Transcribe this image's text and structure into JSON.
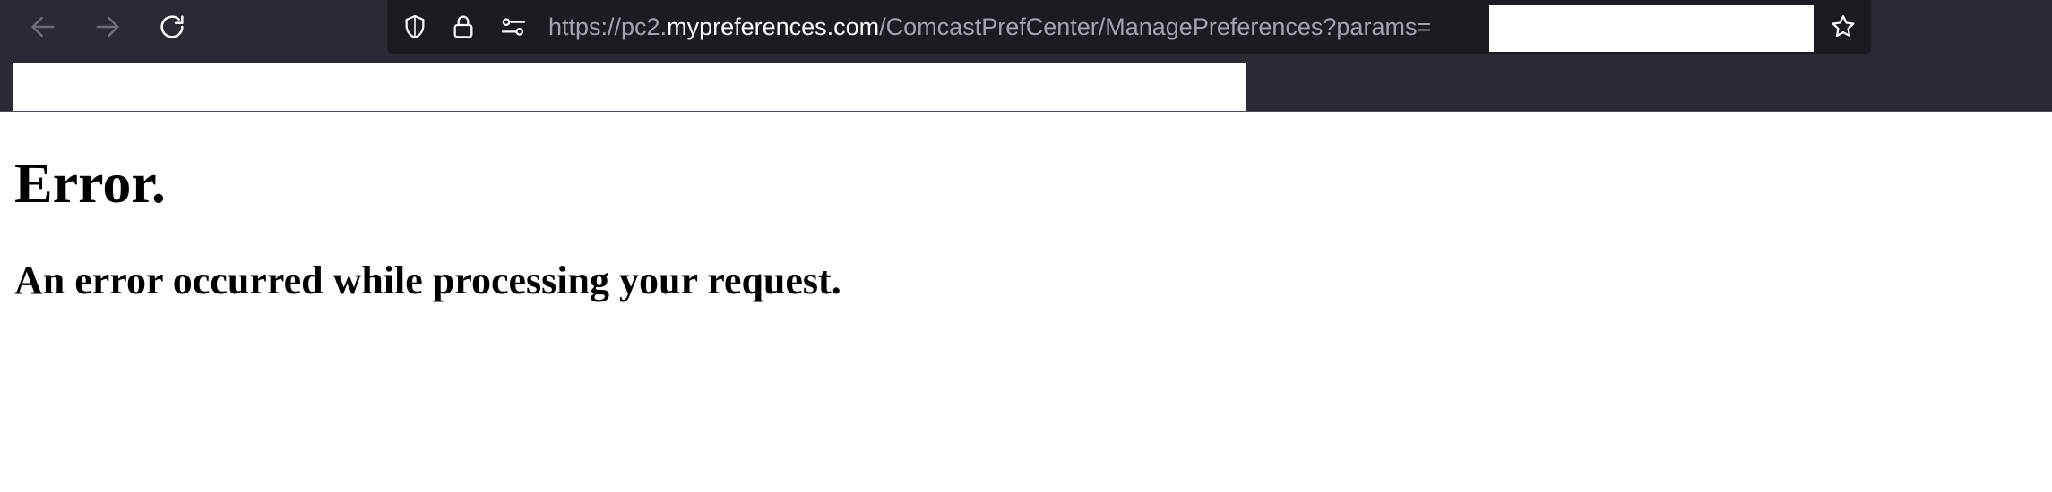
{
  "toolbar": {
    "back_icon": "arrow-left-icon",
    "forward_icon": "arrow-right-icon",
    "reload_icon": "reload-icon",
    "chrome_color": "#2b2a33",
    "urlbar_color": "#1c1b22"
  },
  "urlbar": {
    "scheme_prefix": "https://pc2.",
    "host": "mypreferences.com",
    "path": "/ComcastPrefCenter/ManagePreferences?params=",
    "icons": [
      "shield-icon",
      "lock-icon",
      "permissions-icon",
      "bookmark-star-icon"
    ]
  },
  "page": {
    "heading": "Error.",
    "message": "An error occurred while processing your request."
  }
}
